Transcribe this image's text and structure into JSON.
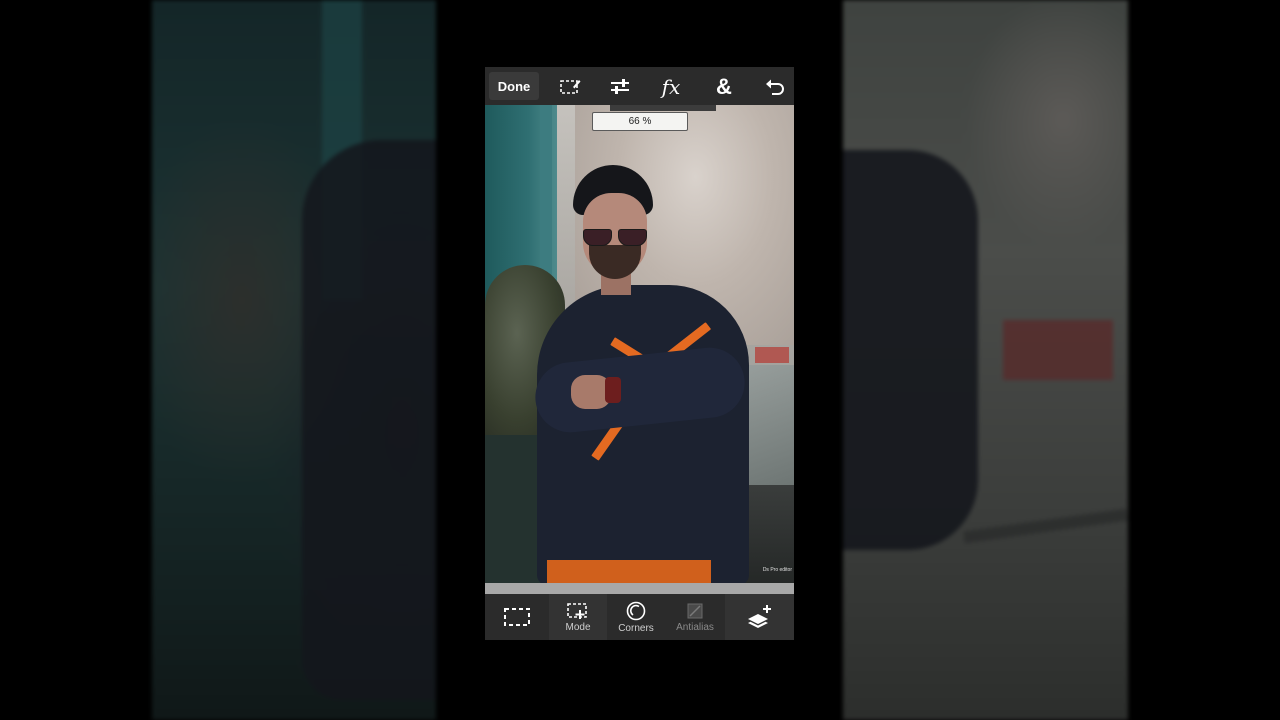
{
  "toolbar": {
    "done_label": "Done",
    "icons": [
      "selection-edit-icon",
      "adjustments-icon",
      "fx-icon",
      "blend-icon",
      "undo-icon"
    ],
    "fx_label": "fx",
    "amp_label": "&"
  },
  "canvas": {
    "zoom_text": "66 %",
    "watermark": "Ds Pro editor"
  },
  "bottom_toolbar": {
    "items": [
      {
        "icon": "rect-select-icon",
        "label": ""
      },
      {
        "icon": "add-selection-icon",
        "label": "Mode"
      },
      {
        "icon": "corners-icon",
        "label": "Corners"
      },
      {
        "icon": "antialias-icon",
        "label": "Antialias"
      },
      {
        "icon": "add-layer-icon",
        "label": ""
      }
    ]
  },
  "colors": {
    "toolbar_bg": "#2b2b2b",
    "shirt_stripe": "#e46a21",
    "background": "#000000"
  }
}
